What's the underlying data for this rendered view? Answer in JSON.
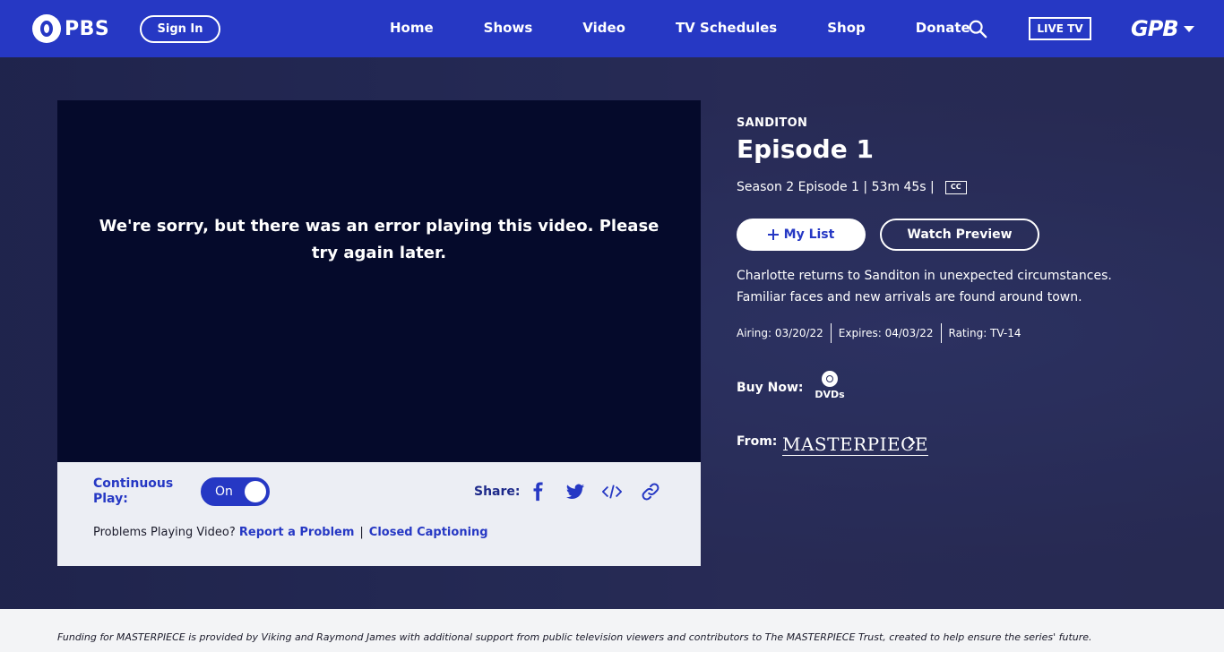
{
  "nav": {
    "logo_text": "PBS",
    "sign_in": "Sign In",
    "links": [
      "Home",
      "Shows",
      "Video",
      "TV Schedules",
      "Shop",
      "Donate"
    ],
    "live_tv": "LIVE TV",
    "station": "GPB"
  },
  "player": {
    "error_message": "We're sorry, but there was an error playing this video. Please try again later.",
    "continuous_play_label": "Continuous Play:",
    "toggle_state": "On",
    "share_label": "Share:",
    "problems_prefix": "Problems Playing Video?",
    "report_link": "Report a Problem",
    "separator": "|",
    "captioning_link": "Closed Captioning"
  },
  "episode": {
    "show": "SANDITON",
    "title": "Episode 1",
    "meta": "Season 2 Episode 1 | 53m 45s |",
    "cc": "CC",
    "my_list": "My List",
    "watch_preview": "Watch Preview",
    "description": "Charlotte returns to Sanditon in unexpected circumstances. Familiar faces and new arrivals are found around town.",
    "airing": "Airing: 03/20/22",
    "expires": "Expires: 04/03/22",
    "rating": "Rating: TV-14",
    "buy_now": "Buy Now:",
    "dvds": "DVDs",
    "from": "From:",
    "from_logo": "MASTERPIECE"
  },
  "footer": {
    "funding": "Funding for MASTERPIECE is provided by Viking and Raymond James with additional support from public television viewers and contributors to The MASTERPIECE Trust, created to help ensure the series' future."
  },
  "icons": {
    "search": "search-icon",
    "facebook": "facebook-icon",
    "twitter": "twitter-icon",
    "embed": "embed-icon",
    "link": "link-icon",
    "chevron": "chevron-right-icon",
    "plus": "plus-icon"
  },
  "colors": {
    "nav_bg": "#2638c4",
    "player_bg": "#050a2b",
    "controls_bg": "#eceef4",
    "link": "#2638c4"
  }
}
